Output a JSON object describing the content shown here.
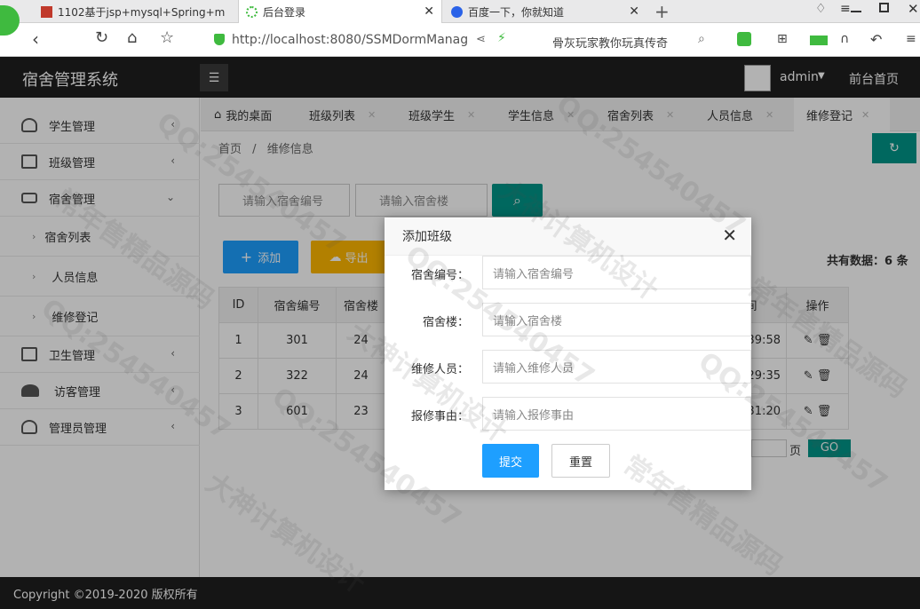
{
  "browser": {
    "tabs": [
      "1102基于jsp+mysql+Spring+m",
      "后台登录",
      "百度一下，你就知道"
    ],
    "url": "http://localhost:8080/SSMDormManag",
    "url_host_bold": "localhost",
    "search_text": "骨灰玩家教你玩真传奇"
  },
  "app": {
    "title": "宿舍管理系统",
    "user": "admin",
    "front_link": "前台首页",
    "footer": "Copyright ©2019-2020 版权所有"
  },
  "sidebar": {
    "items": [
      {
        "label": "学生管理",
        "icon": "user-icon"
      },
      {
        "label": "班级管理",
        "icon": "document-icon"
      },
      {
        "label": "宿舍管理",
        "icon": "inbox-icon"
      },
      {
        "label": "卫生管理",
        "icon": "clipboard-icon"
      },
      {
        "label": "访客管理",
        "icon": "users-icon"
      },
      {
        "label": "管理员管理",
        "icon": "admin-icon"
      }
    ],
    "sub_items": [
      "宿舍列表",
      "人员信息",
      "维修登记"
    ]
  },
  "page_tabs": [
    "我的桌面",
    "班级列表",
    "班级学生",
    "学生信息",
    "宿舍列表",
    "人员信息",
    "维修登记"
  ],
  "breadcrumb": {
    "home": "首页",
    "sep": "/",
    "current": "维修信息"
  },
  "filters": {
    "dorm_no_placeholder": "请输入宿舍编号",
    "building_placeholder": "请输入宿舍楼"
  },
  "toolbar": {
    "add": "添加",
    "export": "导出",
    "total": "共有数据：6 条"
  },
  "table": {
    "headers": [
      "ID",
      "宿舍编号",
      "宿舍楼",
      "更新时间",
      "操作"
    ],
    "rows": [
      {
        "id": "1",
        "dorm_no": "301",
        "building": "24",
        "updated": "-05-13 22:39:58"
      },
      {
        "id": "2",
        "dorm_no": "322",
        "building": "24",
        "updated": "-05-14 16:29:35"
      },
      {
        "id": "3",
        "dorm_no": "601",
        "building": "23",
        "updated": "-05-14 16:31:20"
      }
    ]
  },
  "pager": {
    "page_label": "页",
    "go": "GO"
  },
  "modal": {
    "title": "添加班级",
    "fields": [
      {
        "label": "宿舍编号：",
        "placeholder": "请输入宿舍编号"
      },
      {
        "label": "宿舍楼：",
        "placeholder": "请输入宿舍楼"
      },
      {
        "label": "维修人员：",
        "placeholder": "请输入维修人员"
      },
      {
        "label": "报修事由：",
        "placeholder": "请输入报修事由"
      }
    ],
    "submit": "提交",
    "reset": "重置"
  },
  "watermark": {
    "qq": "QQ:254540457",
    "slogan": "大神计算机设计",
    "slogan2": "常年售精品源码"
  },
  "colors": {
    "primary": "#1e9fff",
    "accent": "#009688",
    "warn": "#ffb800",
    "dark": "#1f1f1f"
  }
}
